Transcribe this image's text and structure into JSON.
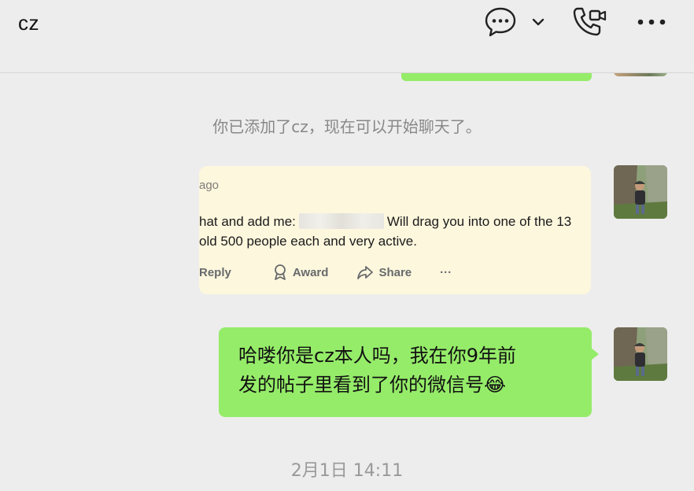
{
  "header": {
    "title": "cz"
  },
  "system_message": "你已添加了cz，现在可以开始聊天了。",
  "quoted_card": {
    "time_fragment": "ago",
    "line1_before": "hat and add me:",
    "line1_after": "Will drag you into one of the 13",
    "line2": "old 500 people each and very active.",
    "actions": {
      "reply": "Reply",
      "award": "Award",
      "share": "Share",
      "more": "···"
    },
    "background": "#fdf7dd"
  },
  "message": {
    "line1": "哈喽你是cz本人吗，我在你9年前",
    "line2": "发的帖子里看到了你的微信号",
    "emoji": "😂",
    "bubble_color": "#95ec69"
  },
  "timestamp": "2月1日 14:11",
  "icons": [
    "chat-bubble-icon",
    "chevron-down-icon",
    "phone-video-icon",
    "more-icon",
    "reply-icon",
    "award-icon",
    "share-icon"
  ]
}
